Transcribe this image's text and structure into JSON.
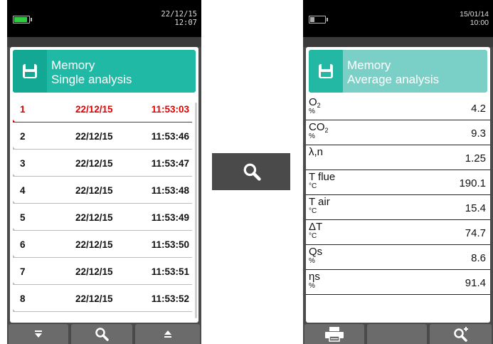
{
  "left_device": {
    "status": {
      "date": "22/12/15",
      "time": "12:07"
    },
    "header": {
      "line1": "Memory",
      "line2": "Single analysis",
      "icon": "save-icon"
    },
    "rows": [
      {
        "num": "1",
        "date": "22/12/15",
        "time": "11:53:03",
        "selected": true
      },
      {
        "num": "2",
        "date": "22/12/15",
        "time": "11:53:46"
      },
      {
        "num": "3",
        "date": "22/12/15",
        "time": "11:53:47"
      },
      {
        "num": "4",
        "date": "22/12/15",
        "time": "11:53:48"
      },
      {
        "num": "5",
        "date": "22/12/15",
        "time": "11:53:49"
      },
      {
        "num": "6",
        "date": "22/12/15",
        "time": "11:53:50"
      },
      {
        "num": "7",
        "date": "22/12/15",
        "time": "11:53:51"
      },
      {
        "num": "8",
        "date": "22/12/15",
        "time": "11:53:52"
      }
    ],
    "buttons": [
      "arrow-down-icon",
      "search-icon",
      "arrow-up-icon"
    ]
  },
  "middle_button": {
    "icon": "search-icon"
  },
  "right_device": {
    "status": {
      "date": "15/01/14",
      "time": "10:00"
    },
    "header": {
      "line1": "Memory",
      "line2": "Average analysis",
      "icon": "save-icon"
    },
    "measurements": [
      {
        "name": "O",
        "sub": "2",
        "unit": "%",
        "value": "4.2"
      },
      {
        "name": "CO",
        "sub": "2",
        "unit": "%",
        "value": "9.3"
      },
      {
        "name": "λ,n",
        "sub": "",
        "unit": "",
        "value": "1.25"
      },
      {
        "name": "T flue",
        "sub": "",
        "unit": "°C",
        "value": "190.1"
      },
      {
        "name": "T air",
        "sub": "",
        "unit": "°C",
        "value": "15.4"
      },
      {
        "name": "ΔT",
        "sub": "",
        "unit": "°C",
        "value": "74.7"
      },
      {
        "name": "Qs",
        "sub": "",
        "unit": "%",
        "value": "8.6"
      },
      {
        "name": "ηs",
        "sub": "",
        "unit": "%",
        "value": "91.4"
      }
    ],
    "buttons": [
      "printer-icon",
      "blank",
      "zoom-in-icon"
    ]
  },
  "colors": {
    "accent": "#1fb9a5",
    "accent_dark": "#12a893",
    "selected_text": "#e00000",
    "device_body": "#4a4a4a"
  }
}
